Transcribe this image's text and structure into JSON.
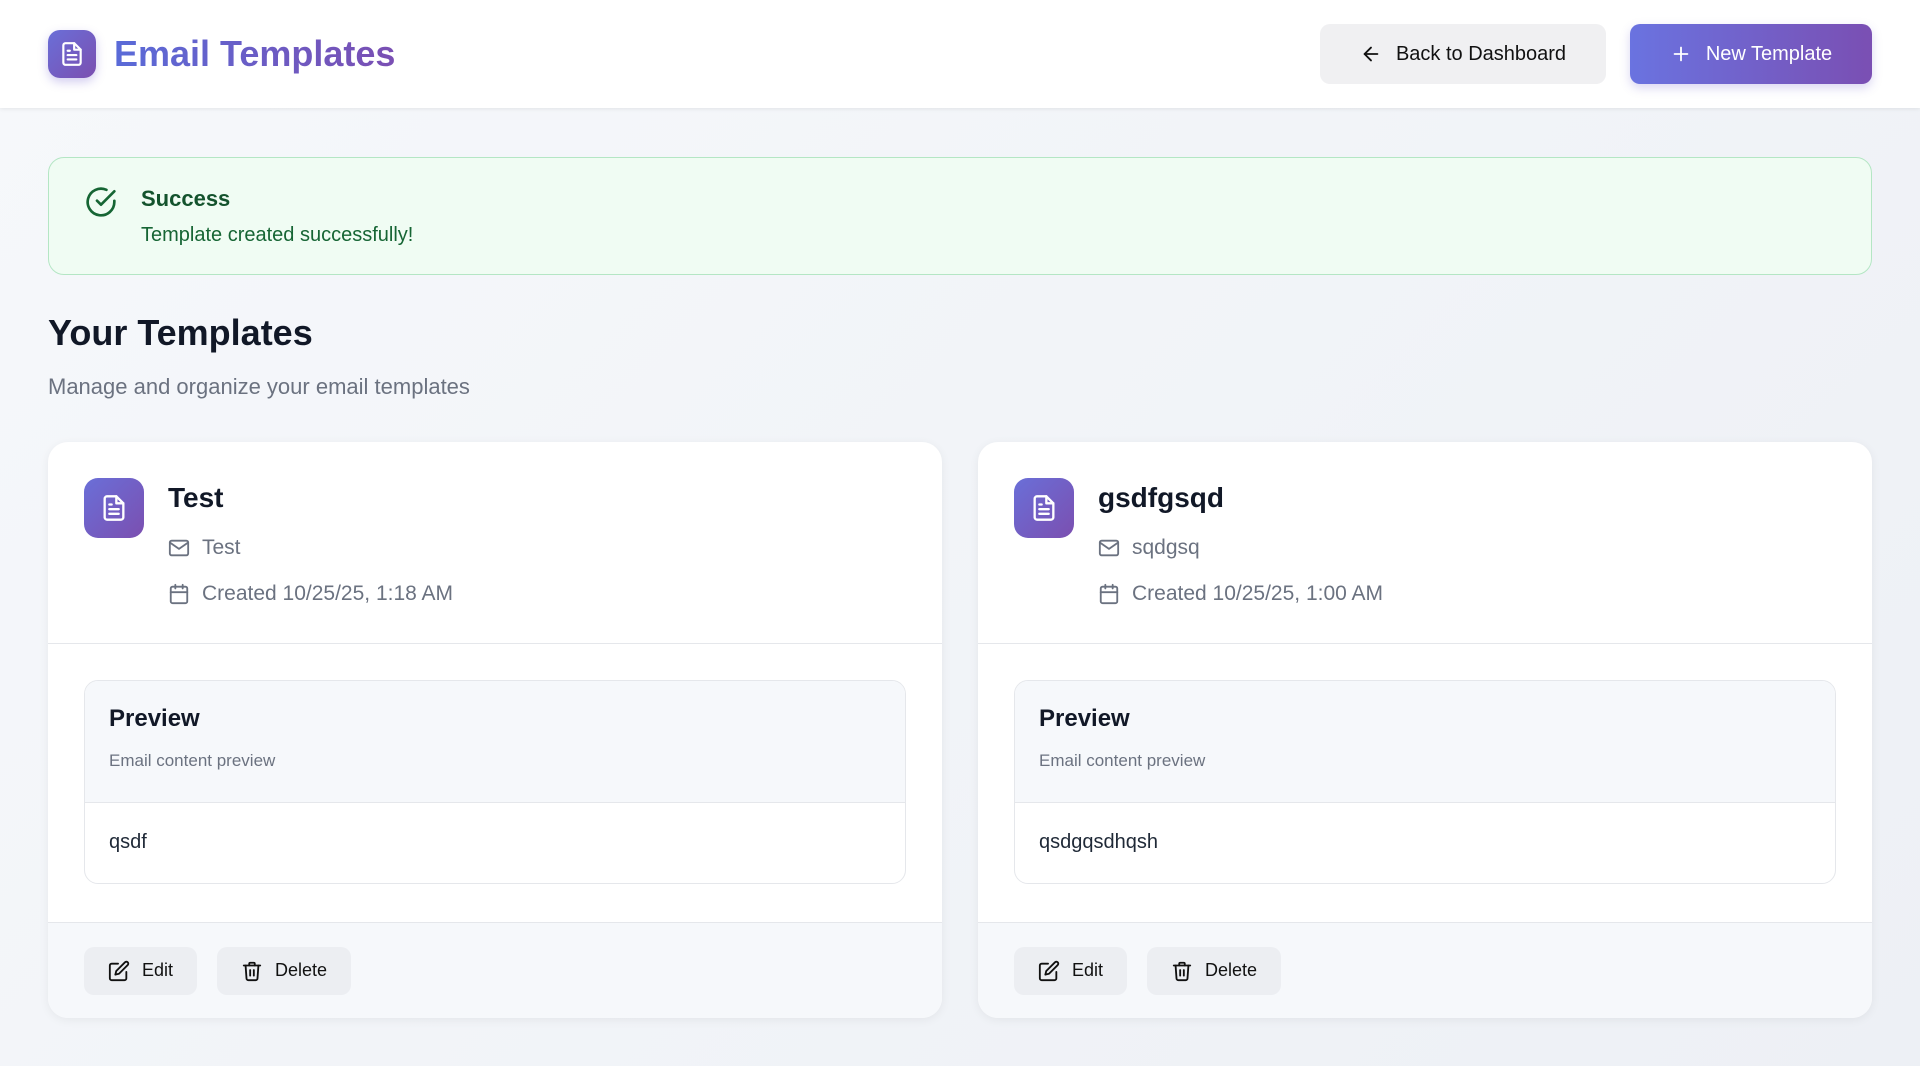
{
  "header": {
    "title": "Email Templates",
    "back_label": "Back to Dashboard",
    "new_label": "New Template"
  },
  "alert": {
    "title": "Success",
    "message": "Template created successfully!"
  },
  "section": {
    "title": "Your Templates",
    "subtitle": "Manage and organize your email templates"
  },
  "templates": [
    {
      "name": "Test",
      "subject": "Test",
      "created": "Created 10/25/25, 1:18 AM",
      "preview_title": "Preview",
      "preview_desc": "Email content preview",
      "content": "qsdf",
      "edit_label": "Edit",
      "delete_label": "Delete"
    },
    {
      "name": "gsdfgsqd",
      "subject": "sqdgsq",
      "created": "Created 10/25/25, 1:00 AM",
      "preview_title": "Preview",
      "preview_desc": "Email content preview",
      "content": "qsdgqsdhqsh",
      "edit_label": "Edit",
      "delete_label": "Delete"
    }
  ],
  "colors": {
    "accent_start": "#6a73e0",
    "accent_end": "#7a4fb3",
    "success_bg": "#f0fcf3",
    "success_border": "#b4e6c4"
  },
  "icons": {
    "brand": "file-text-icon",
    "back": "arrow-left-icon",
    "new": "plus-icon",
    "success": "check-circle-icon",
    "subject": "mail-icon",
    "created": "calendar-icon",
    "edit": "edit-icon",
    "delete": "trash-icon"
  }
}
